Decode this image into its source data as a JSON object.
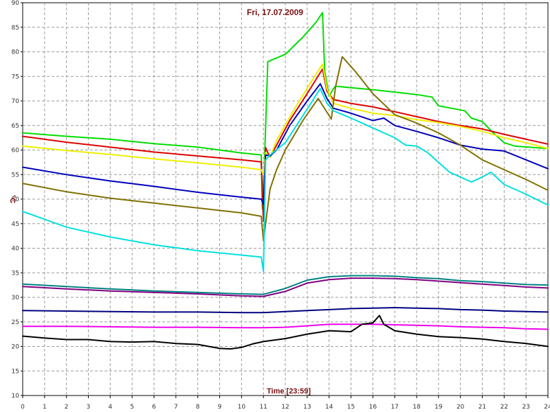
{
  "chart_data": {
    "type": "line",
    "title": "Fri, 17.07.2009",
    "xlabel": "Time [23:59]",
    "ylabel": "°C",
    "xlim": [
      0,
      24
    ],
    "ylim": [
      10,
      90
    ],
    "x_ticks": [
      "0",
      "1",
      "2",
      "3",
      "4",
      "5",
      "6",
      "7",
      "8",
      "9",
      "10",
      "11",
      "12",
      "13",
      "14",
      "15",
      "16",
      "17",
      "18",
      "19",
      "20",
      "21",
      "22",
      "23",
      "24"
    ],
    "y_ticks": [
      "10",
      "15",
      "20",
      "25",
      "30",
      "35",
      "40",
      "45",
      "50",
      "55",
      "60",
      "65",
      "70",
      "75",
      "80",
      "85",
      "90"
    ],
    "grid": true,
    "legend": "none",
    "series": [
      {
        "color": "#00dd00",
        "points": [
          [
            0,
            63.5
          ],
          [
            2,
            62.8
          ],
          [
            4,
            62.2
          ],
          [
            6,
            61.3
          ],
          [
            8,
            60.6
          ],
          [
            10,
            59.4
          ],
          [
            10.9,
            59.0
          ],
          [
            10.95,
            48
          ],
          [
            11.05,
            58
          ],
          [
            11.2,
            78
          ],
          [
            12,
            79.5
          ],
          [
            12.8,
            83
          ],
          [
            13.4,
            86
          ],
          [
            13.7,
            88
          ],
          [
            13.8,
            76
          ],
          [
            14.0,
            71
          ],
          [
            14.2,
            72.5
          ],
          [
            14.3,
            73
          ],
          [
            15,
            72.7
          ],
          [
            16,
            72.3
          ],
          [
            17,
            71.8
          ],
          [
            18,
            71.3
          ],
          [
            18.7,
            70.8
          ],
          [
            19,
            69
          ],
          [
            19.6,
            68.5
          ],
          [
            20.2,
            68
          ],
          [
            20.5,
            66.5
          ],
          [
            21,
            65.8
          ],
          [
            21.5,
            63.5
          ],
          [
            22,
            61.5
          ],
          [
            22.5,
            60.8
          ],
          [
            24,
            60.3
          ]
        ]
      },
      {
        "color": "#dd0000",
        "points": [
          [
            0,
            62.8
          ],
          [
            2,
            61.6
          ],
          [
            4,
            60.6
          ],
          [
            6,
            59.6
          ],
          [
            8,
            58.8
          ],
          [
            10,
            58.0
          ],
          [
            10.9,
            57.6
          ],
          [
            11.0,
            45.5
          ],
          [
            11.1,
            60.5
          ],
          [
            11.3,
            58.5
          ],
          [
            11.6,
            61
          ],
          [
            12.2,
            66
          ],
          [
            13,
            71.5
          ],
          [
            13.7,
            76.5
          ],
          [
            13.9,
            72
          ],
          [
            14.2,
            70.3
          ],
          [
            15,
            69.5
          ],
          [
            16,
            68.8
          ],
          [
            17,
            67.8
          ],
          [
            18,
            66.8
          ],
          [
            19,
            65.8
          ],
          [
            20,
            65
          ],
          [
            21,
            64.3
          ],
          [
            22,
            63.2
          ],
          [
            23,
            62.2
          ],
          [
            24,
            61.2
          ]
        ]
      },
      {
        "color": "#eeee00",
        "points": [
          [
            0,
            60.8
          ],
          [
            2,
            59.9
          ],
          [
            4,
            59.1
          ],
          [
            6,
            58.2
          ],
          [
            8,
            57.4
          ],
          [
            10,
            56.5
          ],
          [
            10.9,
            56.0
          ],
          [
            11.0,
            55
          ],
          [
            11.1,
            59.5
          ],
          [
            11.3,
            58.5
          ],
          [
            11.6,
            62
          ],
          [
            12.5,
            69
          ],
          [
            13.2,
            74
          ],
          [
            13.7,
            77.5
          ],
          [
            13.9,
            72.5
          ],
          [
            14.2,
            69.5
          ],
          [
            15,
            68.5
          ],
          [
            16,
            67.5
          ],
          [
            17,
            67
          ],
          [
            18,
            66.2
          ],
          [
            19,
            65.6
          ],
          [
            20,
            64.8
          ],
          [
            21,
            63.8
          ],
          [
            22,
            62.5
          ],
          [
            23,
            61.5
          ],
          [
            24,
            60.3
          ]
        ]
      },
      {
        "color": "#0000bb",
        "points": [
          [
            0,
            56.5
          ],
          [
            2,
            55
          ],
          [
            4,
            53.7
          ],
          [
            6,
            52.6
          ],
          [
            8,
            51.4
          ],
          [
            10,
            50.4
          ],
          [
            10.9,
            50.0
          ],
          [
            11.0,
            49
          ],
          [
            11.1,
            59
          ],
          [
            11.3,
            58.8
          ],
          [
            11.6,
            60
          ],
          [
            12.2,
            65
          ],
          [
            13,
            70
          ],
          [
            13.6,
            73.5
          ],
          [
            13.9,
            70.5
          ],
          [
            14.2,
            68.5
          ],
          [
            15,
            67.5
          ],
          [
            16,
            66
          ],
          [
            16.5,
            66.5
          ],
          [
            17,
            65
          ],
          [
            18,
            63.8
          ],
          [
            19,
            62.5
          ],
          [
            20,
            61
          ],
          [
            21,
            60.2
          ],
          [
            22,
            59.8
          ],
          [
            23,
            58
          ],
          [
            24,
            56.2
          ]
        ]
      },
      {
        "color": "#807000",
        "points": [
          [
            0,
            53.2
          ],
          [
            2,
            51.5
          ],
          [
            4,
            50.2
          ],
          [
            6,
            49.2
          ],
          [
            8,
            48.2
          ],
          [
            10,
            47.2
          ],
          [
            10.9,
            46.5
          ],
          [
            11.0,
            41.5
          ],
          [
            11.3,
            52
          ],
          [
            11.6,
            56
          ],
          [
            12,
            60
          ],
          [
            12.8,
            66
          ],
          [
            13.5,
            70.5
          ],
          [
            14.0,
            67
          ],
          [
            14.1,
            66.3
          ],
          [
            14.3,
            73
          ],
          [
            14.6,
            79
          ],
          [
            15.2,
            76
          ],
          [
            16,
            71.5
          ],
          [
            17,
            67.2
          ],
          [
            18,
            65.5
          ],
          [
            19,
            63.5
          ],
          [
            20,
            61
          ],
          [
            21,
            58
          ],
          [
            22,
            56
          ],
          [
            23,
            54
          ],
          [
            24,
            51.8
          ]
        ]
      },
      {
        "color": "#00e0e0",
        "points": [
          [
            0,
            47.5
          ],
          [
            2,
            44.3
          ],
          [
            4,
            42.3
          ],
          [
            6,
            40.7
          ],
          [
            8,
            39.5
          ],
          [
            10,
            38.6
          ],
          [
            10.9,
            38.2
          ],
          [
            11.0,
            35.3
          ],
          [
            11.1,
            58
          ],
          [
            11.3,
            59
          ],
          [
            12,
            61.5
          ],
          [
            12.8,
            67
          ],
          [
            13.6,
            72.5
          ],
          [
            13.9,
            69.5
          ],
          [
            14.2,
            68
          ],
          [
            15,
            66.5
          ],
          [
            16,
            64.5
          ],
          [
            17,
            62.5
          ],
          [
            17.5,
            61
          ],
          [
            18,
            60.8
          ],
          [
            18.5,
            59.5
          ],
          [
            19,
            57.5
          ],
          [
            19.5,
            55.5
          ],
          [
            20,
            54.5
          ],
          [
            20.5,
            53.5
          ],
          [
            21,
            54.5
          ],
          [
            21.4,
            55.5
          ],
          [
            22,
            53
          ],
          [
            23,
            51
          ],
          [
            24,
            48.8
          ]
        ]
      },
      {
        "color": "#008080",
        "points": [
          [
            0,
            32.7
          ],
          [
            2,
            32.2
          ],
          [
            4,
            31.7
          ],
          [
            6,
            31.3
          ],
          [
            8,
            31.0
          ],
          [
            10,
            30.7
          ],
          [
            11,
            30.6
          ],
          [
            12,
            31.8
          ],
          [
            13,
            33.5
          ],
          [
            14,
            34.2
          ],
          [
            15,
            34.4
          ],
          [
            16,
            34.4
          ],
          [
            17,
            34.3
          ],
          [
            18,
            34.0
          ],
          [
            19,
            33.8
          ],
          [
            20,
            33.4
          ],
          [
            21,
            33.2
          ],
          [
            22,
            32.9
          ],
          [
            23,
            32.6
          ],
          [
            24,
            32.5
          ]
        ]
      },
      {
        "color": "#800080",
        "points": [
          [
            0,
            32.2
          ],
          [
            2,
            31.7
          ],
          [
            4,
            31.3
          ],
          [
            6,
            31.0
          ],
          [
            8,
            30.7
          ],
          [
            10,
            30.3
          ],
          [
            11,
            30.2
          ],
          [
            12,
            31.2
          ],
          [
            13,
            32.9
          ],
          [
            14,
            33.6
          ],
          [
            15,
            33.9
          ],
          [
            16,
            33.9
          ],
          [
            17,
            33.8
          ],
          [
            18,
            33.6
          ],
          [
            19,
            33.3
          ],
          [
            20,
            33.0
          ],
          [
            21,
            32.7
          ],
          [
            22,
            32.4
          ],
          [
            23,
            32.1
          ],
          [
            24,
            31.9
          ]
        ]
      },
      {
        "color": "#000080",
        "points": [
          [
            0,
            27.3
          ],
          [
            2,
            27.2
          ],
          [
            4,
            27.1
          ],
          [
            6,
            27.0
          ],
          [
            8,
            27.0
          ],
          [
            10,
            26.9
          ],
          [
            11,
            26.9
          ],
          [
            12,
            27.1
          ],
          [
            13,
            27.3
          ],
          [
            14,
            27.5
          ],
          [
            15,
            27.7
          ],
          [
            16,
            27.8
          ],
          [
            17,
            27.9
          ],
          [
            18,
            27.8
          ],
          [
            19,
            27.7
          ],
          [
            20,
            27.5
          ],
          [
            21,
            27.4
          ],
          [
            22,
            27.2
          ],
          [
            23,
            27.1
          ],
          [
            24,
            27.0
          ]
        ]
      },
      {
        "color": "#ee00ee",
        "points": [
          [
            0,
            24.1
          ],
          [
            2,
            24.1
          ],
          [
            4,
            24.0
          ],
          [
            6,
            23.9
          ],
          [
            8,
            23.9
          ],
          [
            10,
            23.8
          ],
          [
            11,
            23.8
          ],
          [
            12,
            23.9
          ],
          [
            13,
            24.2
          ],
          [
            14,
            24.5
          ],
          [
            15,
            24.5
          ],
          [
            16,
            24.5
          ],
          [
            17,
            24.4
          ],
          [
            18,
            24.3
          ],
          [
            19,
            24.2
          ],
          [
            20,
            24.0
          ],
          [
            21,
            23.9
          ],
          [
            22,
            23.8
          ],
          [
            23,
            23.6
          ],
          [
            24,
            23.5
          ]
        ]
      },
      {
        "color": "#000000",
        "points": [
          [
            0,
            22.1
          ],
          [
            1,
            21.7
          ],
          [
            2,
            21.4
          ],
          [
            3,
            21.4
          ],
          [
            4,
            21.0
          ],
          [
            5,
            20.9
          ],
          [
            6,
            21.0
          ],
          [
            7,
            20.6
          ],
          [
            8,
            20.4
          ],
          [
            9,
            19.6
          ],
          [
            9.5,
            19.5
          ],
          [
            10,
            19.8
          ],
          [
            10.5,
            20.5
          ],
          [
            11,
            21.0
          ],
          [
            12,
            21.6
          ],
          [
            13,
            22.5
          ],
          [
            14,
            23.2
          ],
          [
            15,
            23.0
          ],
          [
            15.5,
            24.5
          ],
          [
            16,
            24.8
          ],
          [
            16.3,
            26.3
          ],
          [
            16.5,
            24.5
          ],
          [
            17,
            23.2
          ],
          [
            18,
            22.5
          ],
          [
            19,
            22.0
          ],
          [
            20,
            21.8
          ],
          [
            21,
            21.5
          ],
          [
            22,
            21.0
          ],
          [
            23,
            20.6
          ],
          [
            24,
            20.0
          ]
        ]
      }
    ]
  }
}
